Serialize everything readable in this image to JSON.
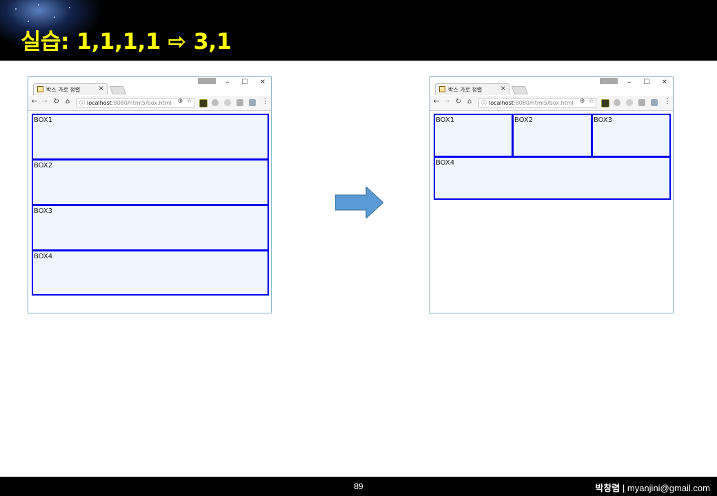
{
  "slide": {
    "title": "실습: 1,1,1,1 ⇨ 3,1",
    "page_number": "89",
    "author_name": "박창렴",
    "author_separator": " | ",
    "author_email": "myanjini@gmail.com"
  },
  "browser": {
    "tab_title": "박스 가로 정렬",
    "tab_close": "×",
    "url_host": "localhost",
    "url_rest": ":8080/html5/box.html",
    "url_info_icon": "ⓘ",
    "minimize": "–",
    "maximize": "☐",
    "close": "✕"
  },
  "before": {
    "boxes": [
      "BOX1",
      "BOX2",
      "BOX3",
      "BOX4"
    ]
  },
  "after": {
    "boxes": [
      "BOX1",
      "BOX2",
      "BOX3",
      "BOX4"
    ]
  },
  "colors": {
    "title": "#ffff00",
    "box_border": "#0000ee",
    "box_fill": "#f0f6ff",
    "arrow": "#5b9bd5"
  }
}
